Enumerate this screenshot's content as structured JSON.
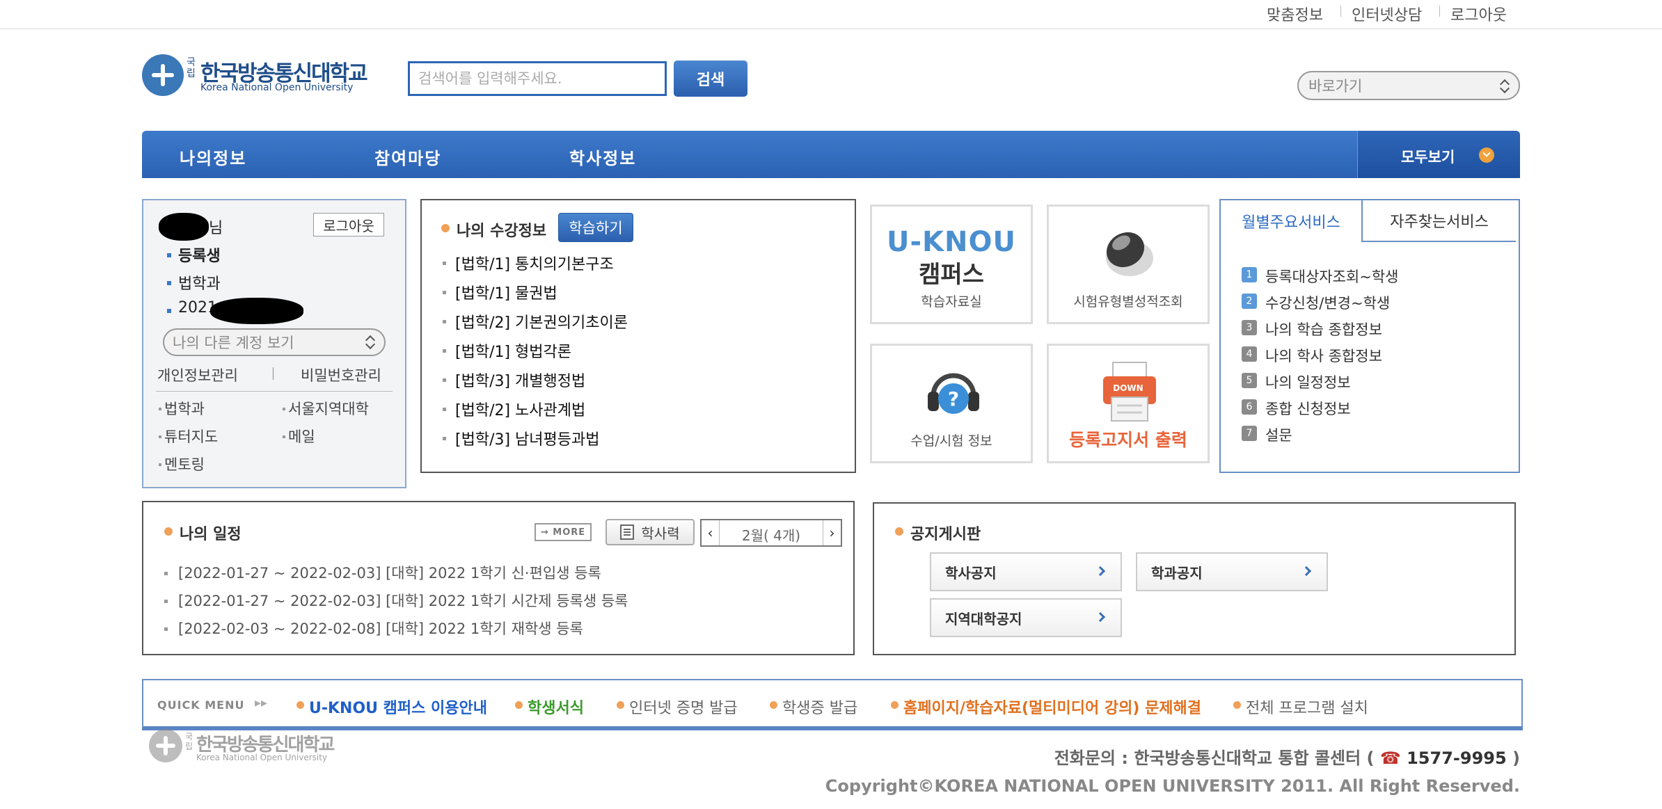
{
  "top_links": [
    "맞춤정보",
    "인터넷상담",
    "로그아웃"
  ],
  "logo": {
    "prefix": "국립",
    "name": "한국방송통신대학교",
    "english": "Korea National Open University"
  },
  "search": {
    "placeholder": "검색어를 입력해주세요.",
    "button": "검색"
  },
  "quick_select": {
    "value": "바로가기"
  },
  "gnb": {
    "items": [
      "나의정보",
      "참여마당",
      "학사정보"
    ],
    "all_view": "모두보기"
  },
  "user": {
    "name_suffix": "님",
    "logout": "로그아웃",
    "status": "등록생",
    "dept": "법학과",
    "id_partial": "2021",
    "other_account": "나의 다른 계정 보기",
    "links": [
      "개인정보관리",
      "비밀번호관리"
    ],
    "shortcuts": [
      "법학과",
      "서울지역대학",
      "튜터지도",
      "메일",
      "멘토링"
    ]
  },
  "courses": {
    "title": "나의 수강정보",
    "study_button": "학습하기",
    "items": [
      "[법학/1] 통치의기본구조",
      "[법학/1] 물권법",
      "[법학/2] 기본권의기초이론",
      "[법학/1] 형법각론",
      "[법학/3] 개별행정법",
      "[법학/2] 노사관계법",
      "[법학/3] 남녀평등과법"
    ]
  },
  "tiles": {
    "ucampus": {
      "logo": "U-KNOU",
      "sub": "캠퍼스",
      "caption": "학습자료실"
    },
    "exam": {
      "caption": "시험유형별성적조회"
    },
    "class": {
      "caption": "수업/시험 정보"
    },
    "register": {
      "badge": "DOWN",
      "caption": "등록고지서 출력"
    }
  },
  "services": {
    "tabs": [
      "월별주요서비스",
      "자주찾는서비스"
    ],
    "items": [
      {
        "num": "1",
        "label": "등록대상자조회~학생"
      },
      {
        "num": "2",
        "label": "수강신청/변경~학생"
      },
      {
        "num": "3",
        "label": "나의 학습 종합정보"
      },
      {
        "num": "4",
        "label": "나의 학사 종합정보"
      },
      {
        "num": "5",
        "label": "나의 일정정보"
      },
      {
        "num": "6",
        "label": "종합 신청정보"
      },
      {
        "num": "7",
        "label": "설문"
      }
    ]
  },
  "schedule": {
    "title": "나의 일정",
    "more": "→ MORE",
    "calendar_button": "학사력",
    "prev": "‹",
    "month": "2월( 4개)",
    "next": "›",
    "items": [
      "[2022-01-27 ~ 2022-02-03] [대학] 2022 1학기 신·편입생 등록",
      "[2022-01-27 ~ 2022-02-03] [대학] 2022 1학기 시간제 등록생 등록",
      "[2022-02-03 ~ 2022-02-08] [대학] 2022 1학기 재학생 등록"
    ]
  },
  "notice": {
    "title": "공지게시판",
    "buttons": [
      "학사공지",
      "학과공지",
      "지역대학공지"
    ]
  },
  "quick_menu": {
    "label": "QUICK MENU",
    "items": [
      {
        "label": "U-KNOU 캠퍼스 이용안내",
        "color": "#1f5fc8"
      },
      {
        "label": "학생서식",
        "color": "#3a9a2a"
      },
      {
        "label": "인터넷 증명 발급",
        "color": "#666666"
      },
      {
        "label": "학생증 발급",
        "color": "#666666"
      },
      {
        "label": "홈페이지/학습자료(멀티미디어 강의) 문제해결",
        "color": "#e0701e"
      },
      {
        "label": "전체 프로그램 설치",
        "color": "#666666"
      }
    ]
  },
  "footer": {
    "contact_prefix": "전화문의 : 한국방송통신대학교 통합 콜센터 (",
    "phone": "1577-9995",
    "contact_suffix": ")",
    "copyright": "Copyright©KOREA NATIONAL OPEN UNIVERSITY 2011. All Right Reserved."
  }
}
